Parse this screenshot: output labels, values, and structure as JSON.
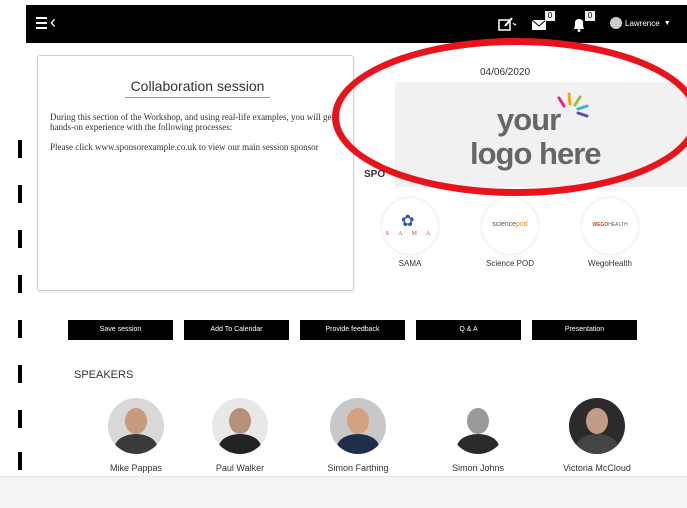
{
  "topbar": {
    "badges": {
      "messages": "0",
      "notifications": "0"
    },
    "user_name": "Lawrence"
  },
  "session": {
    "title": "Collaboration session",
    "description_1": "During this section of the Workshop, and using real-life examples, you will get hands-on experience with the following processes:",
    "description_2": "Please click www.sponsorexample.co.uk to view our main session sponsor"
  },
  "date": "04/06/2020",
  "logo": {
    "line1": "your",
    "line2": "logo here"
  },
  "sponsors": {
    "heading": "SPO",
    "items": [
      {
        "name": "SAMA",
        "logo_text": "S A M A"
      },
      {
        "name": "Science POD",
        "logo_text_a": "science",
        "logo_text_b": "pod"
      },
      {
        "name": "WegoHealth",
        "logo_text_a": "WEGO",
        "logo_text_b": "HEALTH"
      }
    ]
  },
  "actions": [
    "Save session",
    "Add To Calendar",
    "Provide feedback",
    "Q & A",
    "Presentation"
  ],
  "speakers": {
    "heading": "SPEAKERS",
    "items": [
      "Mike Pappas",
      "Paul Walker",
      "Simon Farthing",
      "Simon Johns",
      "Victoria McCloud"
    ]
  },
  "colors": {
    "highlight": "#e8141b",
    "bar": "#000000"
  }
}
